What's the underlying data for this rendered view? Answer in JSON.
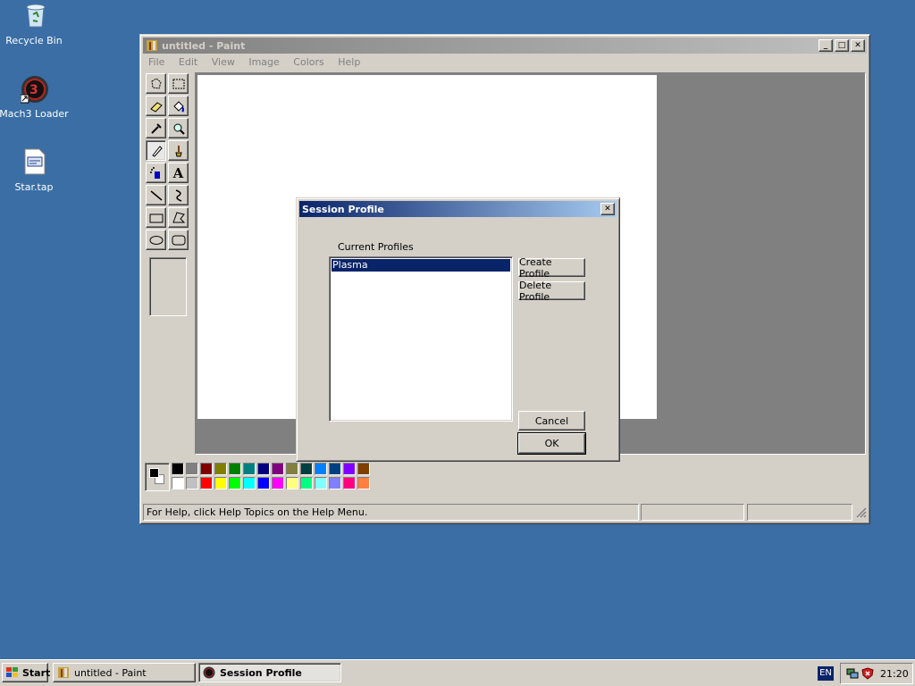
{
  "desktop": {
    "icons": [
      {
        "label": "Recycle Bin",
        "icon": "recycle-bin-icon"
      },
      {
        "label": "Mach3 Loader",
        "icon": "mach3-icon"
      },
      {
        "label": "Star.tap",
        "icon": "file-icon"
      }
    ]
  },
  "paint": {
    "title": "untitled - Paint",
    "menu": [
      "File",
      "Edit",
      "View",
      "Image",
      "Colors",
      "Help"
    ],
    "status": "For Help, click Help Topics on the Help Menu.",
    "palette_top": [
      "#000000",
      "#808080",
      "#800000",
      "#808000",
      "#008000",
      "#008080",
      "#000080",
      "#800080",
      "#808040",
      "#004040",
      "#0080ff",
      "#004080",
      "#8000ff",
      "#804000"
    ],
    "palette_bottom": [
      "#ffffff",
      "#c0c0c0",
      "#ff0000",
      "#ffff00",
      "#00ff00",
      "#00ffff",
      "#0000ff",
      "#ff00ff",
      "#ffff80",
      "#00ff80",
      "#80ffff",
      "#8080ff",
      "#ff0080",
      "#ff8040"
    ]
  },
  "dialog": {
    "title": "Session Profile",
    "group_label": "Current Profiles",
    "profiles": [
      "Plasma"
    ],
    "create_label": "Create Profile",
    "delete_label": "Delete Profile",
    "cancel_label": "Cancel",
    "ok_label": "OK"
  },
  "taskbar": {
    "start": "Start",
    "tasks": [
      {
        "label": "untitled - Paint"
      },
      {
        "label": "Session Profile"
      }
    ],
    "lang": "EN",
    "clock": "21:20"
  }
}
